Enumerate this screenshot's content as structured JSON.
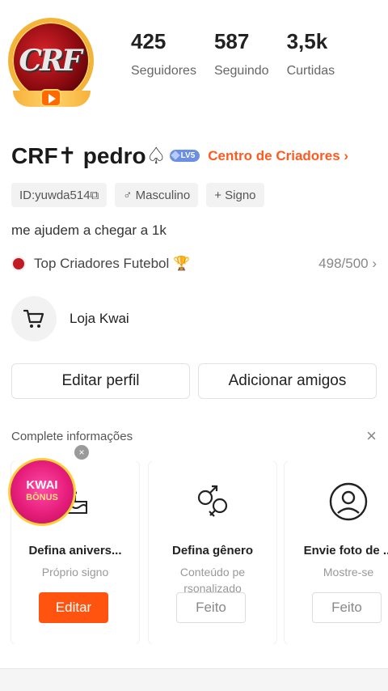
{
  "profile": {
    "name": "CRF✝ pedro♤",
    "level": "LV5",
    "creator_link": "Centro de Criadores ›",
    "avatar_text": "CRF"
  },
  "stats": [
    {
      "value": "425",
      "label": "Seguidores"
    },
    {
      "value": "587",
      "label": "Seguindo"
    },
    {
      "value": "3,5k",
      "label": "Curtidas"
    }
  ],
  "tags": [
    {
      "label": "ID:yuwda514⧉"
    },
    {
      "label": "♂ Masculino"
    },
    {
      "label": "+ Signo"
    }
  ],
  "bio": "me ajudem a chegar a 1k",
  "ranking": {
    "label": "Top Criadores Futebol 🏆",
    "value": "498/500 ›"
  },
  "shop": {
    "label": "Loja Kwai"
  },
  "actions": {
    "edit_profile": "Editar perfil",
    "add_friends": "Adicionar amigos"
  },
  "complete": {
    "title": "Complete informações",
    "close": "×",
    "cards": [
      {
        "title": "Defina anivers...",
        "sub": "Próprio signo",
        "button": "Editar"
      },
      {
        "title": "Defina gênero",
        "sub": "Conteúdo pe rsonalizado",
        "button": "Feito"
      },
      {
        "title": "Envie foto de ...",
        "sub": "Mostre-se",
        "button": "Feito"
      }
    ]
  },
  "kwai_badge": {
    "line1": "KWAI",
    "line2": "BÔNUS",
    "close": "×"
  },
  "colors": {
    "accent": "#ff5410",
    "link": "#ff5a1f"
  }
}
